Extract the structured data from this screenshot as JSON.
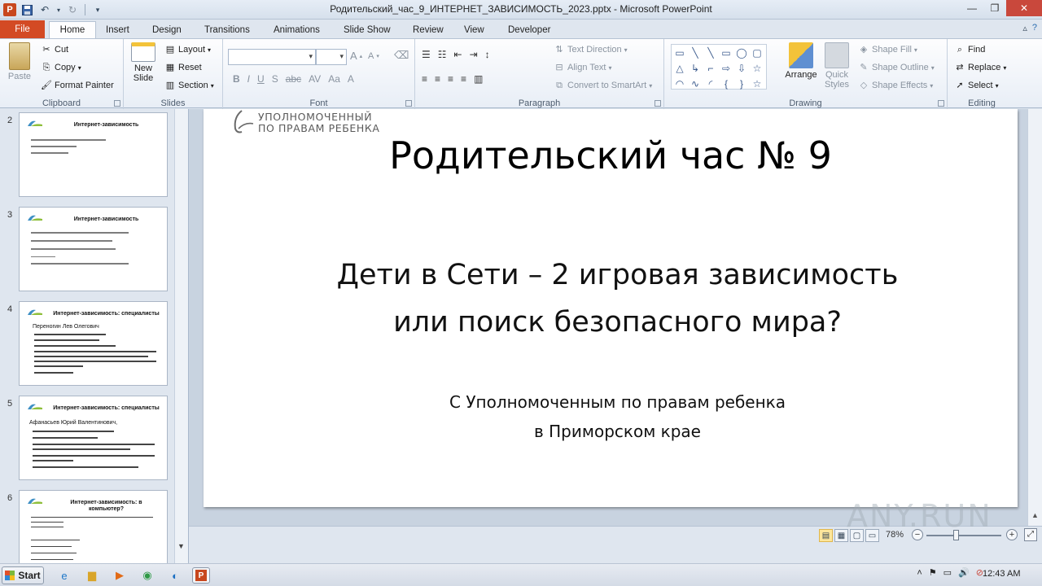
{
  "window": {
    "title": "Родительский_час_9_ИНТЕРНЕТ_ЗАВИСИМОСТЬ_2023.pptx - Microsoft PowerPoint"
  },
  "tabs": [
    "File",
    "Home",
    "Insert",
    "Design",
    "Transitions",
    "Animations",
    "Slide Show",
    "Review",
    "View",
    "Developer"
  ],
  "ribbon": {
    "clipboard": {
      "paste": "Paste",
      "cut": "Cut",
      "copy": "Copy",
      "format_painter": "Format Painter",
      "label": "Clipboard"
    },
    "slides": {
      "new_slide_1": "New",
      "new_slide_2": "Slide",
      "layout": "Layout",
      "reset": "Reset",
      "section": "Section",
      "label": "Slides"
    },
    "font": {
      "label": "Font",
      "bold": "B",
      "italic": "I",
      "underline": "U",
      "strike": "S",
      "spacing": "abc",
      "grow": "A",
      "shrink": "A"
    },
    "paragraph": {
      "text_direction": "Text Direction",
      "align_text": "Align Text",
      "convert": "Convert to SmartArt",
      "label": "Paragraph"
    },
    "drawing": {
      "arrange": "Arrange",
      "quick_1": "Quick",
      "quick_2": "Styles",
      "shape_fill": "Shape Fill",
      "shape_outline": "Shape Outline",
      "shape_effects": "Shape Effects",
      "label": "Drawing"
    },
    "editing": {
      "find": "Find",
      "replace": "Replace",
      "select": "Select",
      "label": "Editing"
    }
  },
  "thumbnails": [
    {
      "num": "2",
      "title": "Интернет-зависимость"
    },
    {
      "num": "3",
      "title": "Интернет-зависимость"
    },
    {
      "num": "4",
      "title": "Интернет-зависимость: специалисты",
      "name": "Переногин Лев Олегович"
    },
    {
      "num": "5",
      "title": "Интернет-зависимость: специалисты",
      "name": "Афанасьев Юрий Валентинович,"
    },
    {
      "num": "6",
      "title": "Интернет-зависимость: в компьютер?"
    }
  ],
  "slide": {
    "logo_line1": "УПОЛНОМОЧЕННЫЙ",
    "logo_line2": "ПО ПРАВАМ РЕБЕНКА",
    "title": "Родительский час № 9",
    "subtitle_line1": "Дети в Сети – 2 игровая зависимость",
    "subtitle_line2": "или поиск безопасного мира?",
    "footer_line1": "С Уполномоченным по правам ребенка",
    "footer_line2": "в Приморском крае"
  },
  "status": {
    "zoom": "78%"
  },
  "taskbar": {
    "start": "Start",
    "clock": "12:43 AM"
  },
  "watermark": "ANY.RUN"
}
